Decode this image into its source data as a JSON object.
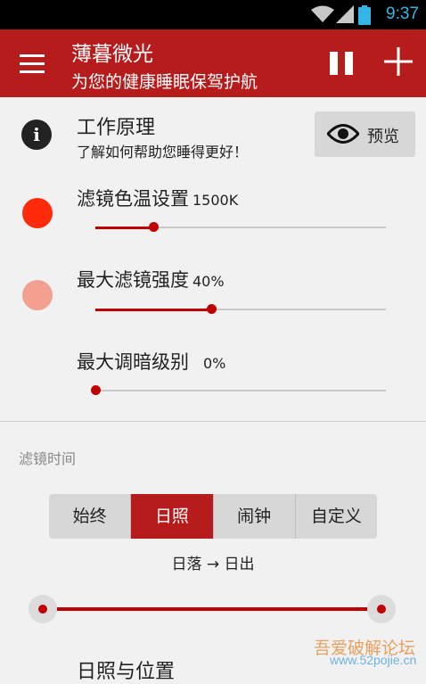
{
  "status_bar": {
    "time": "9:37"
  },
  "app_bar": {
    "title": "薄暮微光",
    "subtitle": "为您的健康睡眠保驾护航"
  },
  "info": {
    "title": "工作原理",
    "description": "了解如何帮助您睡得更好！",
    "preview_label": "预览"
  },
  "sliders": [
    {
      "label": "滤镜色温设置",
      "value_text": "1500K",
      "fraction": 0.2,
      "dot_color": "#ff2a0a"
    },
    {
      "label": "最大滤镜强度",
      "value_text": "40%",
      "fraction": 0.4,
      "dot_color": "#f4a090"
    },
    {
      "label": "最大调暗级别",
      "value_text": "0%",
      "fraction": 0.0
    }
  ],
  "filter_time": {
    "section_title": "滤镜时间",
    "options": [
      "始终",
      "日照",
      "闹钟",
      "自定义"
    ],
    "selected": "日照",
    "range_label": "日落 → 日出"
  },
  "sun_position": {
    "title": "日照与位置"
  },
  "watermark": {
    "line1": "吾爱破解论坛",
    "line2": "www.52pojie.cn"
  },
  "colors": {
    "accent": "#b71c1c",
    "slider": "#c00000"
  }
}
